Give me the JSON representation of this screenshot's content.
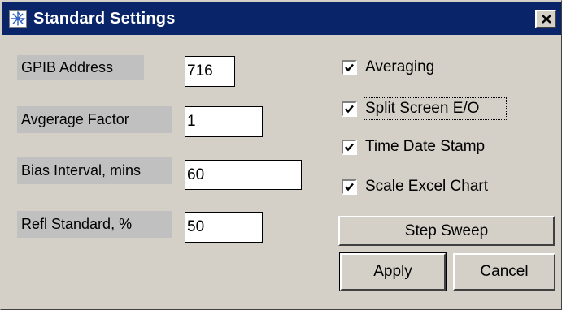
{
  "window": {
    "title": "Standard Settings",
    "icon": "agilent-spark-icon",
    "close_icon": "close-icon"
  },
  "fields": [
    {
      "label": "GPIB Address",
      "value": "716"
    },
    {
      "label": "Avgerage Factor",
      "value": "1"
    },
    {
      "label": "Bias Interval, mins",
      "value": "60"
    },
    {
      "label": "Refl Standard, %",
      "value": "50"
    }
  ],
  "checkboxes": [
    {
      "label": "Averaging",
      "checked": true
    },
    {
      "label": "Split Screen E/O",
      "checked": true,
      "focused": true
    },
    {
      "label": "Time Date Stamp",
      "checked": true
    },
    {
      "label": "Scale Excel Chart",
      "checked": true
    }
  ],
  "buttons": {
    "step_sweep": "Step Sweep",
    "apply": "Apply",
    "cancel": "Cancel"
  },
  "colors": {
    "titlebar": "#0a246a",
    "dialog_face": "#d4d0c8",
    "label_background": "#c0c0c0"
  }
}
